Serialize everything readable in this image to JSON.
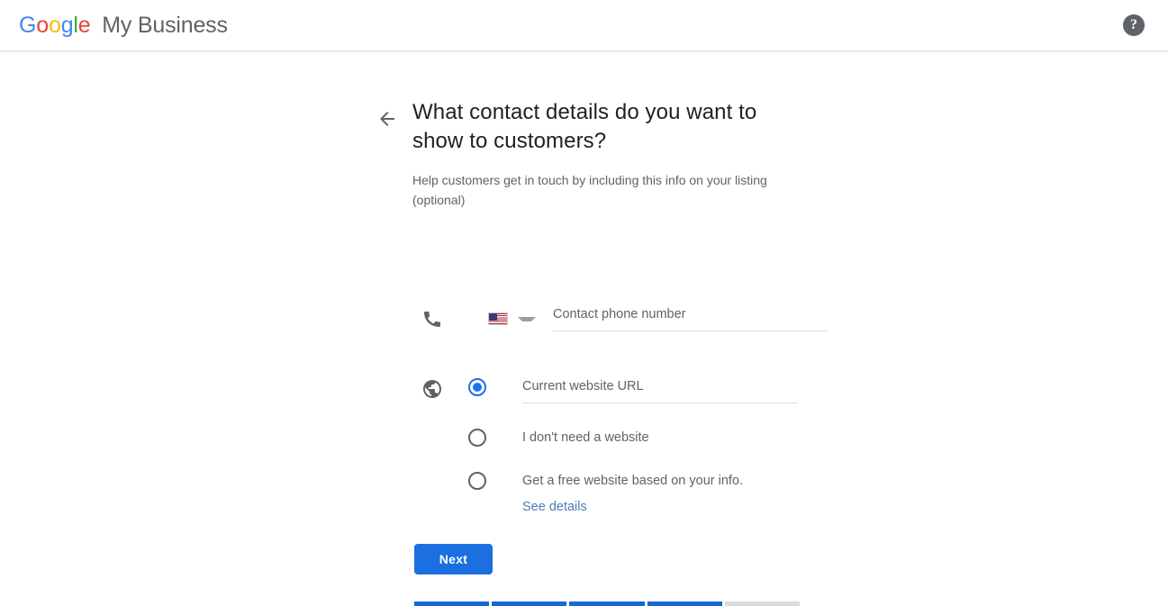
{
  "header": {
    "brand": {
      "google_letters": [
        {
          "ch": "G",
          "color": "#4285F4"
        },
        {
          "ch": "o",
          "color": "#EA4335"
        },
        {
          "ch": "o",
          "color": "#FBBC05"
        },
        {
          "ch": "g",
          "color": "#4285F4"
        },
        {
          "ch": "l",
          "color": "#34A853"
        },
        {
          "ch": "e",
          "color": "#EA4335"
        }
      ],
      "product": "My Business"
    },
    "help_icon": "?",
    "help_icon_name": "help-icon"
  },
  "main": {
    "back_arrow": "←",
    "title": "What contact details do you want to show to customers?",
    "subtitle": "Help customers get in touch by including this info on your listing (optional)",
    "phone": {
      "icon": "phone-icon",
      "country": "US",
      "placeholder": "Contact phone number",
      "value": ""
    },
    "website": {
      "icon": "globe-icon",
      "options": [
        {
          "label": "Current website URL",
          "selected": true,
          "is_input": true
        },
        {
          "label": "I don't need a website",
          "selected": false,
          "is_input": false
        },
        {
          "label": "Get a free website based on your info.",
          "selected": false,
          "is_input": false
        }
      ],
      "see_details_link": "See details"
    },
    "next_label": "Next",
    "progress": {
      "total_steps": 5,
      "completed_steps": 4,
      "active_color": "#1967D2",
      "inactive_color": "#DADCE0"
    }
  }
}
